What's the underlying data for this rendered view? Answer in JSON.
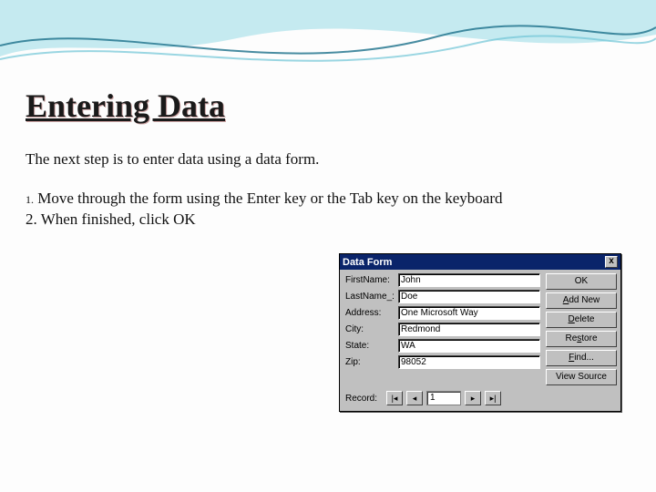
{
  "slide": {
    "title": "Entering Data",
    "intro": "The next step is to enter data using a data form.",
    "step1_num": "1.",
    "step1_text": " Move through the form using the Enter key or the Tab key on the keyboard",
    "step2": "2.  When finished, click OK"
  },
  "dataform": {
    "title": "Data Form",
    "close": "x",
    "fields": [
      {
        "label": "FirstName:",
        "value": "John"
      },
      {
        "label": "LastName_:",
        "value": "Doe"
      },
      {
        "label": "Address:",
        "value": "One Microsoft Way"
      },
      {
        "label": "City:",
        "value": "Redmond"
      },
      {
        "label": "State:",
        "value": "WA"
      },
      {
        "label": "Zip:",
        "value": "98052"
      }
    ],
    "buttons": {
      "ok": "OK",
      "addnew": "Add New",
      "delete": "Delete",
      "restore": "Restore",
      "find": "Find...",
      "viewsource": "View Source"
    },
    "record": {
      "label": "Record:",
      "num": "1"
    }
  }
}
